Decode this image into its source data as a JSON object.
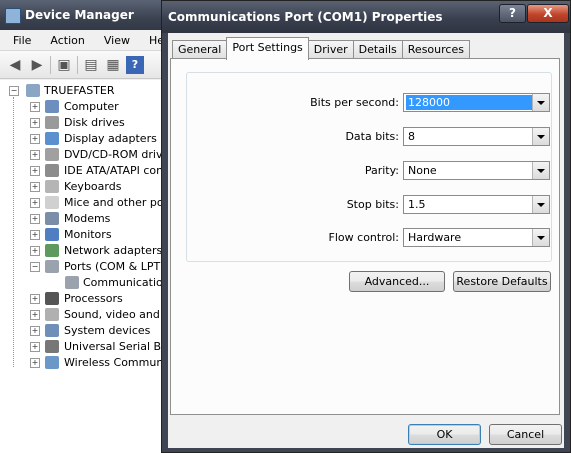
{
  "device_manager": {
    "title": "Device Manager",
    "menu": [
      "File",
      "Action",
      "View",
      "Help"
    ],
    "toolbar_icons": [
      "back-arrow-icon",
      "forward-arrow-icon",
      "properties-icon",
      "view-icon",
      "print-icon",
      "help-icon"
    ],
    "tree": {
      "root": "TRUEFASTER",
      "nodes": [
        {
          "label": "Computer",
          "expanded": false,
          "icon": "computer-icon"
        },
        {
          "label": "Disk drives",
          "expanded": false,
          "icon": "disk-icon"
        },
        {
          "label": "Display adapters",
          "expanded": false,
          "icon": "display-icon"
        },
        {
          "label": "DVD/CD-ROM drives",
          "expanded": false,
          "icon": "dvd-icon"
        },
        {
          "label": "IDE ATA/ATAPI cont",
          "expanded": false,
          "icon": "ide-icon"
        },
        {
          "label": "Keyboards",
          "expanded": false,
          "icon": "keyboard-icon"
        },
        {
          "label": "Mice and other poin",
          "expanded": false,
          "icon": "mouse-icon"
        },
        {
          "label": "Modems",
          "expanded": false,
          "icon": "modem-icon"
        },
        {
          "label": "Monitors",
          "expanded": false,
          "icon": "monitor-icon"
        },
        {
          "label": "Network adapters",
          "expanded": false,
          "icon": "network-icon"
        },
        {
          "label": "Ports (COM & LPT)",
          "expanded": true,
          "icon": "port-icon"
        },
        {
          "label": "Communications",
          "child": true,
          "icon": "port-icon"
        },
        {
          "label": "Processors",
          "expanded": false,
          "icon": "processor-icon"
        },
        {
          "label": "Sound, video and ga",
          "expanded": false,
          "icon": "sound-icon"
        },
        {
          "label": "System devices",
          "expanded": false,
          "icon": "system-icon"
        },
        {
          "label": "Universal Serial Bus",
          "expanded": false,
          "icon": "usb-icon"
        },
        {
          "label": "Wireless Communica",
          "expanded": false,
          "icon": "wireless-icon"
        }
      ]
    }
  },
  "dialog": {
    "title": "Communications Port (COM1) Properties",
    "help_glyph": "?",
    "close_glyph": "X",
    "tabs": [
      "General",
      "Port Settings",
      "Driver",
      "Details",
      "Resources"
    ],
    "active_tab": "Port Settings",
    "fields": [
      {
        "label": "Bits per second:",
        "value": "128000",
        "focused": true
      },
      {
        "label": "Data bits:",
        "value": "8"
      },
      {
        "label": "Parity:",
        "value": "None"
      },
      {
        "label": "Stop bits:",
        "value": "1.5"
      },
      {
        "label": "Flow control:",
        "value": "Hardware"
      }
    ],
    "advanced_button": "Advanced...",
    "restore_button": "Restore Defaults",
    "ok_button": "OK",
    "cancel_button": "Cancel"
  }
}
